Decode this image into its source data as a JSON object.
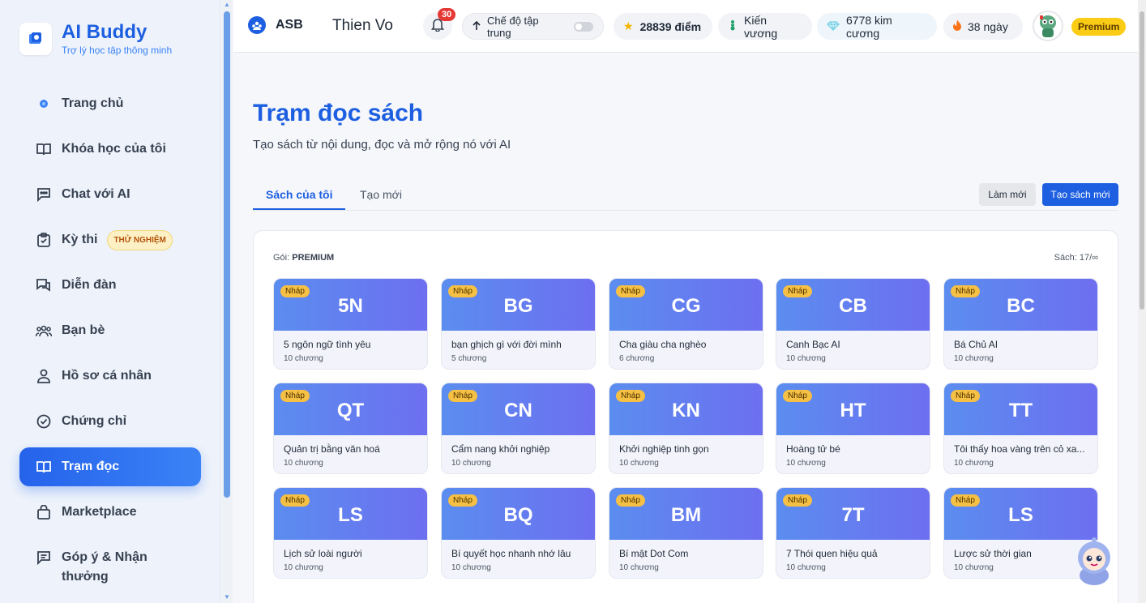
{
  "brand": {
    "title": "AI Buddy",
    "subtitle": "Trợ lý học tập thông minh"
  },
  "sidebar": {
    "items": [
      {
        "label": "Trang chủ",
        "icon": "home-icon"
      },
      {
        "label": "Khóa học của tôi",
        "icon": "book-open-icon"
      },
      {
        "label": "Chat với AI",
        "icon": "chat-icon"
      },
      {
        "label": "Kỳ thi",
        "icon": "clipboard-check-icon",
        "badge": "THỬ NGHIỆM"
      },
      {
        "label": "Diễn đàn",
        "icon": "forum-icon"
      },
      {
        "label": "Bạn bè",
        "icon": "users-icon"
      },
      {
        "label": "Hồ sơ cá nhân",
        "icon": "user-icon"
      },
      {
        "label": "Chứng chỉ",
        "icon": "certificate-icon"
      },
      {
        "label": "Trạm đọc",
        "icon": "book-open-icon",
        "active": true
      },
      {
        "label": "Marketplace",
        "icon": "bag-icon"
      },
      {
        "label": "Góp ý & Nhận thưởng",
        "icon": "feedback-icon"
      }
    ]
  },
  "topbar": {
    "org": "ASB",
    "user": "Thien Vo",
    "notifications": "30",
    "focus_mode": "Chế độ tập trung",
    "points": "28839 điểm",
    "rank": "Kiến vương",
    "diamonds": "6778 kim cương",
    "streak": "38 ngày",
    "plan_badge": "Premium"
  },
  "main": {
    "title": "Trạm đọc sách",
    "subtitle": "Tạo sách từ nội dung, đọc và mở rộng nó với AI",
    "tabs": [
      "Sách của tôi",
      "Tạo mới"
    ],
    "refresh_button": "Làm mới",
    "create_button": "Tạo sách mới",
    "plan_label": "Gói:",
    "plan_value": "PREMIUM",
    "books_count": "Sách: 17/∞",
    "draft_label": "Nháp"
  },
  "books": [
    {
      "abbr": "5N",
      "title": "5 ngôn ngữ tình yêu",
      "chapters": "10 chương"
    },
    {
      "abbr": "BG",
      "title": "bạn ghịch gì với đời mình",
      "chapters": "5 chương"
    },
    {
      "abbr": "CG",
      "title": "Cha giàu cha nghèo",
      "chapters": "6 chương"
    },
    {
      "abbr": "CB",
      "title": "Canh Bạc AI",
      "chapters": "10 chương"
    },
    {
      "abbr": "BC",
      "title": "Bá Chủ AI",
      "chapters": "10 chương"
    },
    {
      "abbr": "QT",
      "title": "Quản trị bằng văn hoá",
      "chapters": "10 chương"
    },
    {
      "abbr": "CN",
      "title": "Cẩm nang khởi nghiệp",
      "chapters": "10 chương"
    },
    {
      "abbr": "KN",
      "title": "Khởi nghiệp tinh gọn",
      "chapters": "10 chương"
    },
    {
      "abbr": "HT",
      "title": "Hoàng tử bé",
      "chapters": "10 chương"
    },
    {
      "abbr": "TT",
      "title": "Tôi thấy hoa vàng trên cỏ xa...",
      "chapters": "10 chương"
    },
    {
      "abbr": "LS",
      "title": "Lịch sử loài người",
      "chapters": "10 chương"
    },
    {
      "abbr": "BQ",
      "title": "Bí quyết học nhanh nhớ lâu",
      "chapters": "10 chương"
    },
    {
      "abbr": "BM",
      "title": "Bí mật Dot Com",
      "chapters": "10 chương"
    },
    {
      "abbr": "7T",
      "title": "7 Thói quen hiệu quả",
      "chapters": "10 chương"
    },
    {
      "abbr": "LS",
      "title": "Lược sử thời gian",
      "chapters": "10 chương"
    }
  ]
}
